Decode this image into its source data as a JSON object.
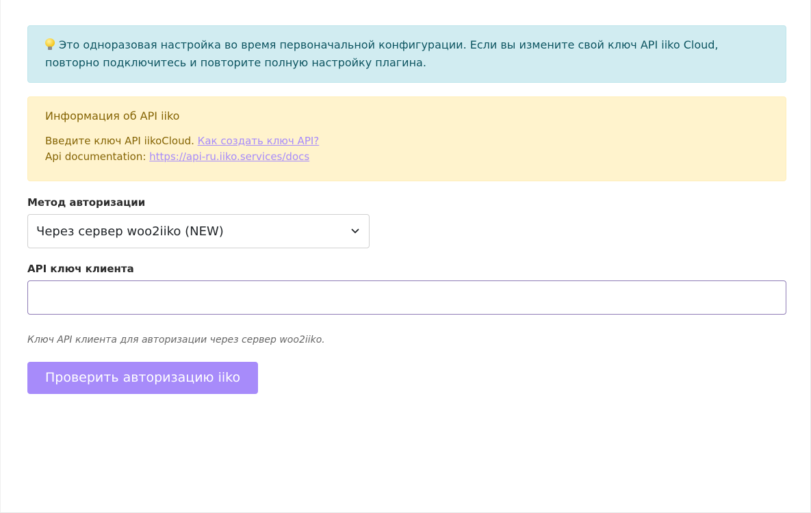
{
  "info_alert": {
    "icon": "lightbulb-icon",
    "text_line1": "Это одноразовая настройка во время первоначальной конфигурации. Если вы измените свой ключ API iiko Cloud,",
    "text_line2": "повторно подключитесь и повторите полную настройку плагина."
  },
  "api_info": {
    "heading": "Информация об API iiko",
    "line1_text": "Введите ключ API iikoCloud. ",
    "line1_link": "Как создать ключ API?",
    "line2_text": "Api documentation: ",
    "line2_link": "https://api-ru.iiko.services/docs"
  },
  "auth_method": {
    "label": "Метод авторизации",
    "selected": "Через сервер woo2iiko (NEW)"
  },
  "client_key": {
    "label": "API ключ клиента",
    "value": "",
    "placeholder": "",
    "help": "Ключ API клиента для авторизации через сервер woo2iiko."
  },
  "actions": {
    "check_button": "Проверить авторизацию iiko"
  },
  "colors": {
    "accent": "#a78bfa",
    "info_bg": "#d1ecf1",
    "warning_bg": "#fff3cd"
  }
}
